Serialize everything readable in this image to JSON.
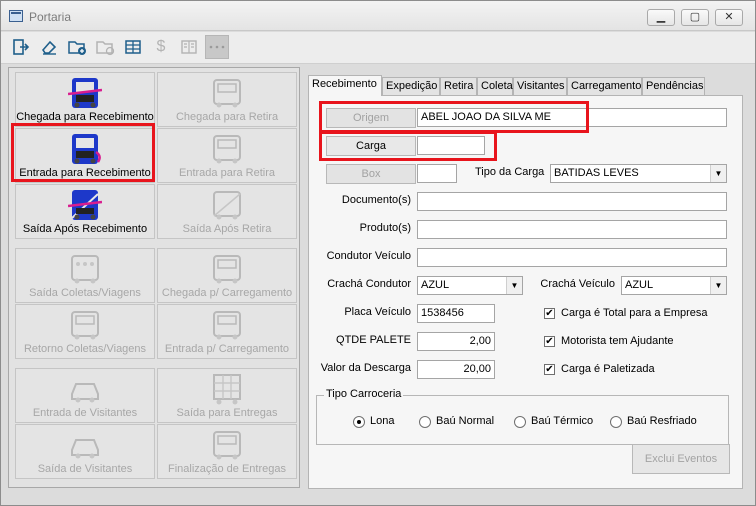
{
  "window": {
    "title": "Portaria",
    "min_label": "▁",
    "max_label": "▢",
    "close_label": "✕"
  },
  "toolbar": {
    "icons": [
      "exit-icon",
      "eraser-icon",
      "new-folder-icon",
      "folder-edit-icon",
      "grid-icon",
      "dollar-icon",
      "card-icon",
      "ellipsis-icon"
    ],
    "dollar_glyph": "$"
  },
  "left_buttons": [
    {
      "label": "Chegada para Recebimento",
      "enabled": true
    },
    {
      "label": "Chegada para Retira",
      "enabled": false
    },
    {
      "label": "Entrada para Recebimento",
      "enabled": true,
      "highlighted": true
    },
    {
      "label": "Entrada para Retira",
      "enabled": false
    },
    {
      "label": "Saída Após Recebimento",
      "enabled": true
    },
    {
      "label": "Saída Após Retira",
      "enabled": false
    },
    {
      "label": "Saída Coletas/Viagens",
      "enabled": false
    },
    {
      "label": "Chegada p/ Carregamento",
      "enabled": false
    },
    {
      "label": "Retorno Coletas/Viagens",
      "enabled": false
    },
    {
      "label": "Entrada p/ Carregamento",
      "enabled": false
    },
    {
      "label": "Entrada de Visitantes",
      "enabled": false
    },
    {
      "label": "Saída para Entregas",
      "enabled": false
    },
    {
      "label": "Saída de Visitantes",
      "enabled": false
    },
    {
      "label": "Finalização de Entregas",
      "enabled": false
    }
  ],
  "tabs": [
    "Recebimento",
    "Expedição",
    "Retira",
    "Coleta",
    "Visitantes",
    "Carregamento",
    "Pendências"
  ],
  "form": {
    "origem_label": "Origem",
    "origem_value": "ABEL JOAO DA SILVA ME",
    "carga_label": "Carga",
    "carga_value": "",
    "box_label": "Box",
    "box_value": "",
    "tipo_carga_label": "Tipo da Carga",
    "tipo_carga_value": "BATIDAS LEVES",
    "documentos_label": "Documento(s)",
    "documentos_value": "",
    "produtos_label": "Produto(s)",
    "produtos_value": "",
    "condutor_label": "Condutor Veículo",
    "condutor_value": "",
    "cracha_condutor_label": "Crachá Condutor",
    "cracha_condutor_value": "AZUL",
    "cracha_veiculo_label": "Crachá Veículo",
    "cracha_veiculo_value": "AZUL",
    "placa_label": "Placa Veículo",
    "placa_value": "1538456",
    "qtde_label": "QTDE PALETE",
    "qtde_value": "2,00",
    "valor_label": "Valor da Descarga",
    "valor_value": "20,00",
    "checks": [
      {
        "label": "Carga é Total para a Empresa",
        "checked": true
      },
      {
        "label": "Motorista tem Ajudante",
        "checked": true
      },
      {
        "label": "Carga é Paletizada",
        "checked": true
      }
    ],
    "check_mark": "✔",
    "tipo_carroceria_title": "Tipo Carroceria",
    "radios": [
      {
        "label": "Lona",
        "selected": true
      },
      {
        "label": "Baú Normal",
        "selected": false
      },
      {
        "label": "Baú Térmico",
        "selected": false
      },
      {
        "label": "Baú Resfriado",
        "selected": false
      }
    ],
    "excluir_label": "Exclui Eventos",
    "dropdown_arrow": "▼"
  },
  "colors": {
    "highlight": "#e8141c",
    "truck_blue": "#1d38c9",
    "truck_magenta": "#d81d8f"
  }
}
